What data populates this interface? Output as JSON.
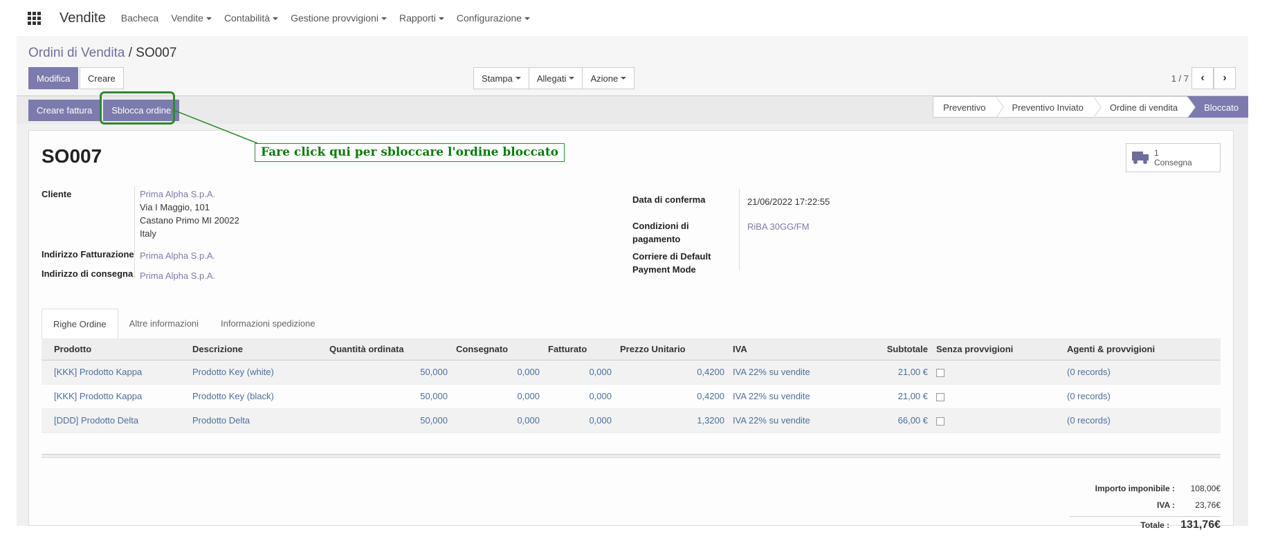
{
  "nav": {
    "app_name": "Vendite",
    "menu": [
      {
        "label": "Bacheca",
        "caret": false
      },
      {
        "label": "Vendite",
        "caret": true
      },
      {
        "label": "Contabilità",
        "caret": true
      },
      {
        "label": "Gestione provvigioni",
        "caret": true
      },
      {
        "label": "Rapporti",
        "caret": true
      },
      {
        "label": "Configurazione",
        "caret": true
      }
    ]
  },
  "breadcrumb": {
    "parent": "Ordini di Vendita",
    "separator": "/",
    "current": "SO007"
  },
  "buttons": {
    "edit": "Modifica",
    "create": "Creare",
    "print": "Stampa",
    "attachments": "Allegati",
    "action": "Azione"
  },
  "pager": {
    "value": "1 / 7",
    "prev": "‹",
    "next": "›"
  },
  "status": {
    "create_invoice": "Creare fattura",
    "unlock": "Sblocca ordine",
    "steps": [
      "Preventivo",
      "Preventivo Inviato",
      "Ordine di vendita",
      "Bloccato"
    ],
    "active_step": "Bloccato"
  },
  "order": {
    "name": "SO007",
    "delivery_count": "1",
    "delivery_label": "Consegna",
    "customer_label": "Cliente",
    "customer_name": "Prima Alpha S.p.A.",
    "customer_address": [
      "Via I Maggio, 101",
      "Castano Primo MI 20022",
      "Italy"
    ],
    "invoice_address_label": "Indirizzo Fatturazione",
    "invoice_address": "Prima Alpha S.p.A.",
    "delivery_address_label": "Indirizzo di consegna",
    "delivery_address": "Prima Alpha S.p.A.",
    "confirm_date_label": "Data di conferma",
    "confirm_date": "21/06/2022 17:22:55",
    "payment_terms_label_1": "Condizioni di",
    "payment_terms_label_2": "pagamento",
    "payment_terms": "RiBA 30GG/FM",
    "payment_mode_label_1": "Corriere di Default",
    "payment_mode_label_2": "Payment Mode"
  },
  "tabs": [
    "Righe Ordine",
    "Altre informazioni",
    "Informazioni spedizione"
  ],
  "lines": {
    "headers": [
      "Prodotto",
      "Descrizione",
      "Quantità ordinata",
      "Consegnato",
      "Fatturato",
      "Prezzo Unitario",
      "IVA",
      "Subtotale",
      "Senza provvigioni",
      "Agenti & provvigioni"
    ],
    "rows": [
      [
        "[KKK] Prodotto Kappa",
        "Prodotto Key (white)",
        "50,000",
        "0,000",
        "0,000",
        "0,4200",
        "IVA 22% su vendite",
        "21,00 €",
        "",
        "(0 records)"
      ],
      [
        "[KKK] Prodotto Kappa",
        "Prodotto Key (black)",
        "50,000",
        "0,000",
        "0,000",
        "0,4200",
        "IVA 22% su vendite",
        "21,00 €",
        "",
        "(0 records)"
      ],
      [
        "[DDD] Prodotto Delta",
        "Prodotto Delta",
        "50,000",
        "0,000",
        "0,000",
        "1,3200",
        "IVA 22% su vendite",
        "66,00 €",
        "",
        "(0 records)"
      ]
    ]
  },
  "totals": {
    "untaxed_label": "Importo imponibile :",
    "untaxed": "108,00€",
    "tax_label": "IVA :",
    "tax": "23,76€",
    "total_label": "Totale :",
    "total": "131,76€"
  },
  "annotation": {
    "text": "Fare click qui per sbloccare l'ordine bloccato",
    "color": "#2d8a2d"
  },
  "colors": {
    "primary": "#7c7bad",
    "link": "#4a6f9e"
  }
}
